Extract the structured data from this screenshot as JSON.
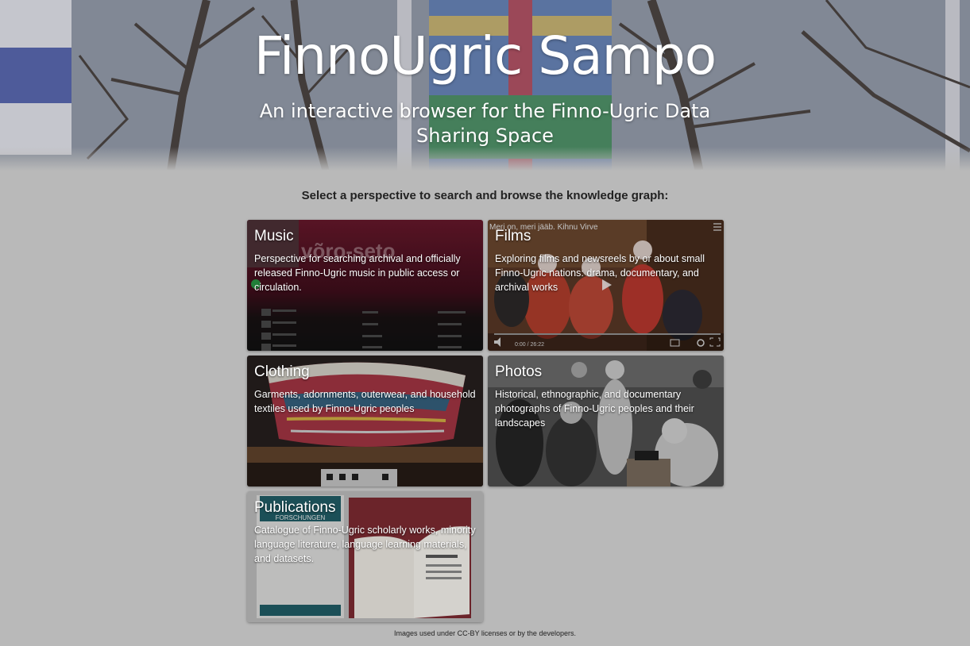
{
  "hero": {
    "title": "FinnoUgric Sampo",
    "subtitle": "An interactive browser for the Finno-Ugric Data Sharing Space"
  },
  "prompt": "Select a perspective to search and browse the knowledge graph:",
  "cards": [
    {
      "title": "Music",
      "description": "Perspective for searching archival and officially released Finno-Ugric music in public access or circulation.",
      "image_text": "võro-seto"
    },
    {
      "title": "Films",
      "description": "Exploring films and newsreels by or about small Finno-Ugric nations: drama, documentary, and archival works",
      "image_text": "Meri on, meri jääb. Kihnu Virve",
      "video_time": "0:00 / 26:22"
    },
    {
      "title": "Clothing",
      "description": "Garments, adornments, outerwear, and household textiles used by Finno-Ugric peoples"
    },
    {
      "title": "Photos",
      "description": "Historical, ethnographic, and documentary photographs of Finno-Ugric peoples and their landscapes"
    },
    {
      "title": "Publications",
      "description": "Catalogue of Finno-Ugric scholarly works, minority language literature, language learning materials, and datasets.",
      "image_text": "FORSCHUNGEN"
    }
  ],
  "footer": "Images used under CC-BY licenses or by the developers.",
  "colors": {
    "page_background": "#b9b9b9",
    "hero_text": "#ffffff",
    "prompt_text": "#222222",
    "music_accent": "#6b1a2e",
    "publications_teal": "#1f5a63"
  },
  "icons": [
    "play-icon",
    "settings-icon",
    "fullscreen-icon",
    "subtitles-icon",
    "volume-icon",
    "filter-icon"
  ]
}
